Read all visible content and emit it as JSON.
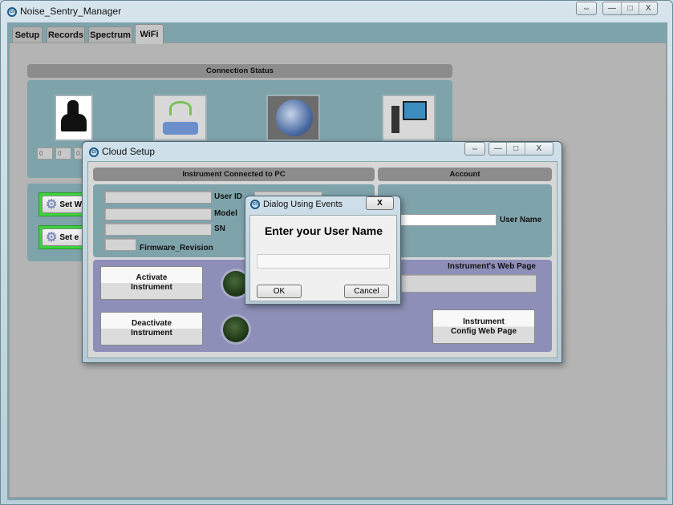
{
  "main_window": {
    "title": "Noise_Sentry_Manager",
    "controls": {
      "restore": "⇔",
      "minimize": "—",
      "maximize": "□",
      "close": "X"
    }
  },
  "tabs": [
    {
      "label": "Setup"
    },
    {
      "label": "Records"
    },
    {
      "label": "Spectrum"
    },
    {
      "label": "WiFi",
      "active": true
    }
  ],
  "wifi": {
    "connection_status": "Connection Status",
    "counters": [
      "0",
      "0",
      "0"
    ],
    "buttons": [
      "Set W",
      "Set e"
    ],
    "images": [
      "noise-sentry-instrument",
      "wifi-router",
      "earth-globe",
      "desktop-computer"
    ]
  },
  "cloud_setup": {
    "title": "Cloud Setup",
    "instrument_header": "Instrument Connected to PC",
    "account_header": "Account",
    "fields": {
      "user_id": "User ID",
      "model": "Model",
      "sn": "SN",
      "firmware": "Firmware_Revision"
    },
    "user_name_label": "User Name",
    "web_page_label": "Instrument's Web Page",
    "activate": "Activate Instrument",
    "deactivate": "Deactivate Instrument",
    "config_web_page": "Instrument Config Web Page",
    "led_color": "#1f3a18"
  },
  "dialog": {
    "title": "Dialog Using Events",
    "prompt": "Enter your User Name",
    "input_value": "",
    "ok": "OK",
    "cancel": "Cancel",
    "close": "X"
  }
}
